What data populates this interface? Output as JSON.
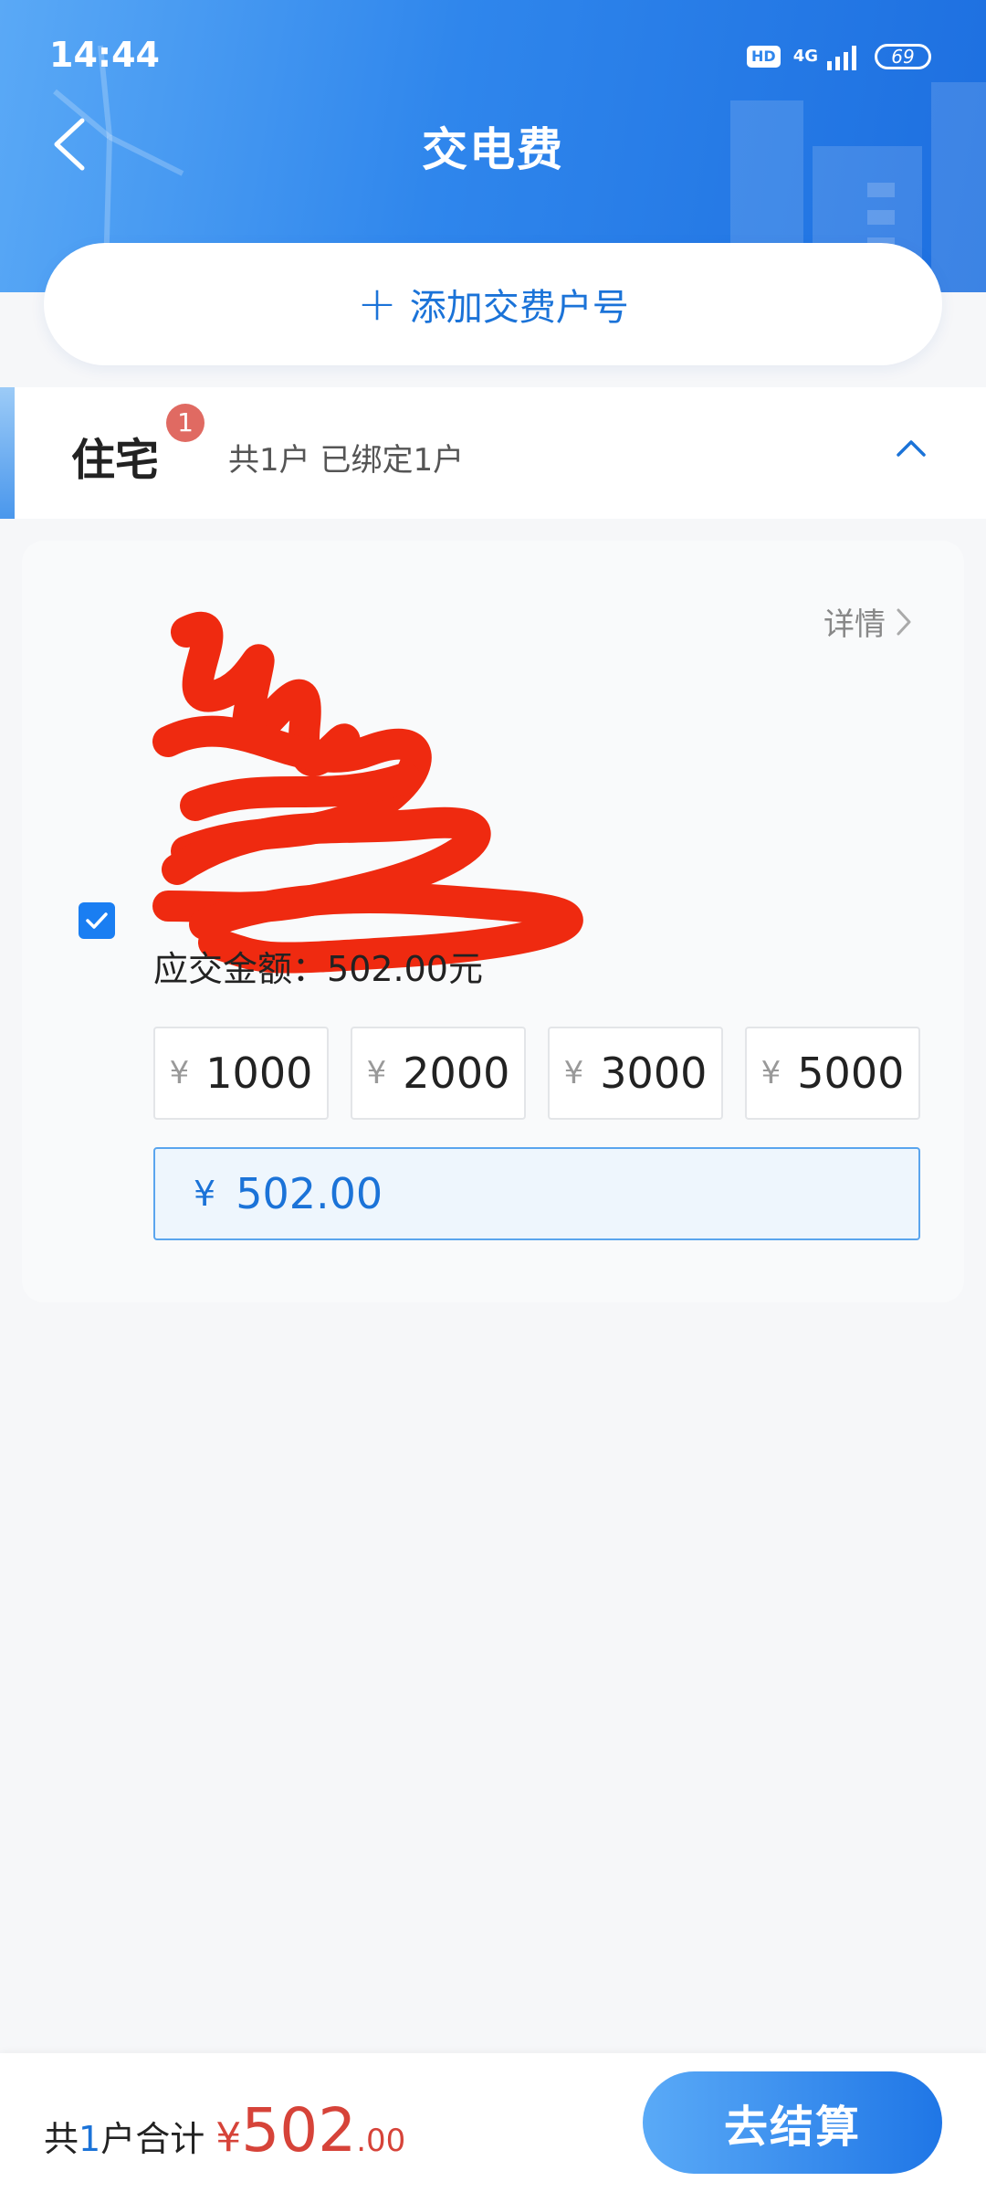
{
  "status_bar": {
    "time": "14:44",
    "hd": "HD",
    "network": "4G",
    "battery": "69"
  },
  "header": {
    "title": "交电费",
    "back_icon": "chevron-left-icon"
  },
  "add_account": {
    "plus": "+",
    "label": "添加交费户号"
  },
  "category": {
    "title": "住宅",
    "badge": "1",
    "summary": "共1户 已绑定1户",
    "toggle_icon": "chevron-up-icon"
  },
  "account_card": {
    "details_label": "详情",
    "checked": true,
    "due_label": "应交金额：",
    "due_amount": "502.00元",
    "quick_amounts": [
      {
        "currency": "¥",
        "value": "1000"
      },
      {
        "currency": "¥",
        "value": "2000"
      },
      {
        "currency": "¥",
        "value": "3000"
      },
      {
        "currency": "¥",
        "value": "5000"
      }
    ],
    "custom_amount": {
      "currency": "¥",
      "value": "502.00"
    }
  },
  "footer": {
    "total_prefix": "共",
    "count": "1",
    "total_suffix": "户合计",
    "currency": "¥",
    "amount_int": "502",
    "amount_dec": ".00",
    "checkout_label": "去结算"
  },
  "colors": {
    "primary": "#1b73d8",
    "accent_red": "#d64339",
    "badge": "#e06a62"
  }
}
